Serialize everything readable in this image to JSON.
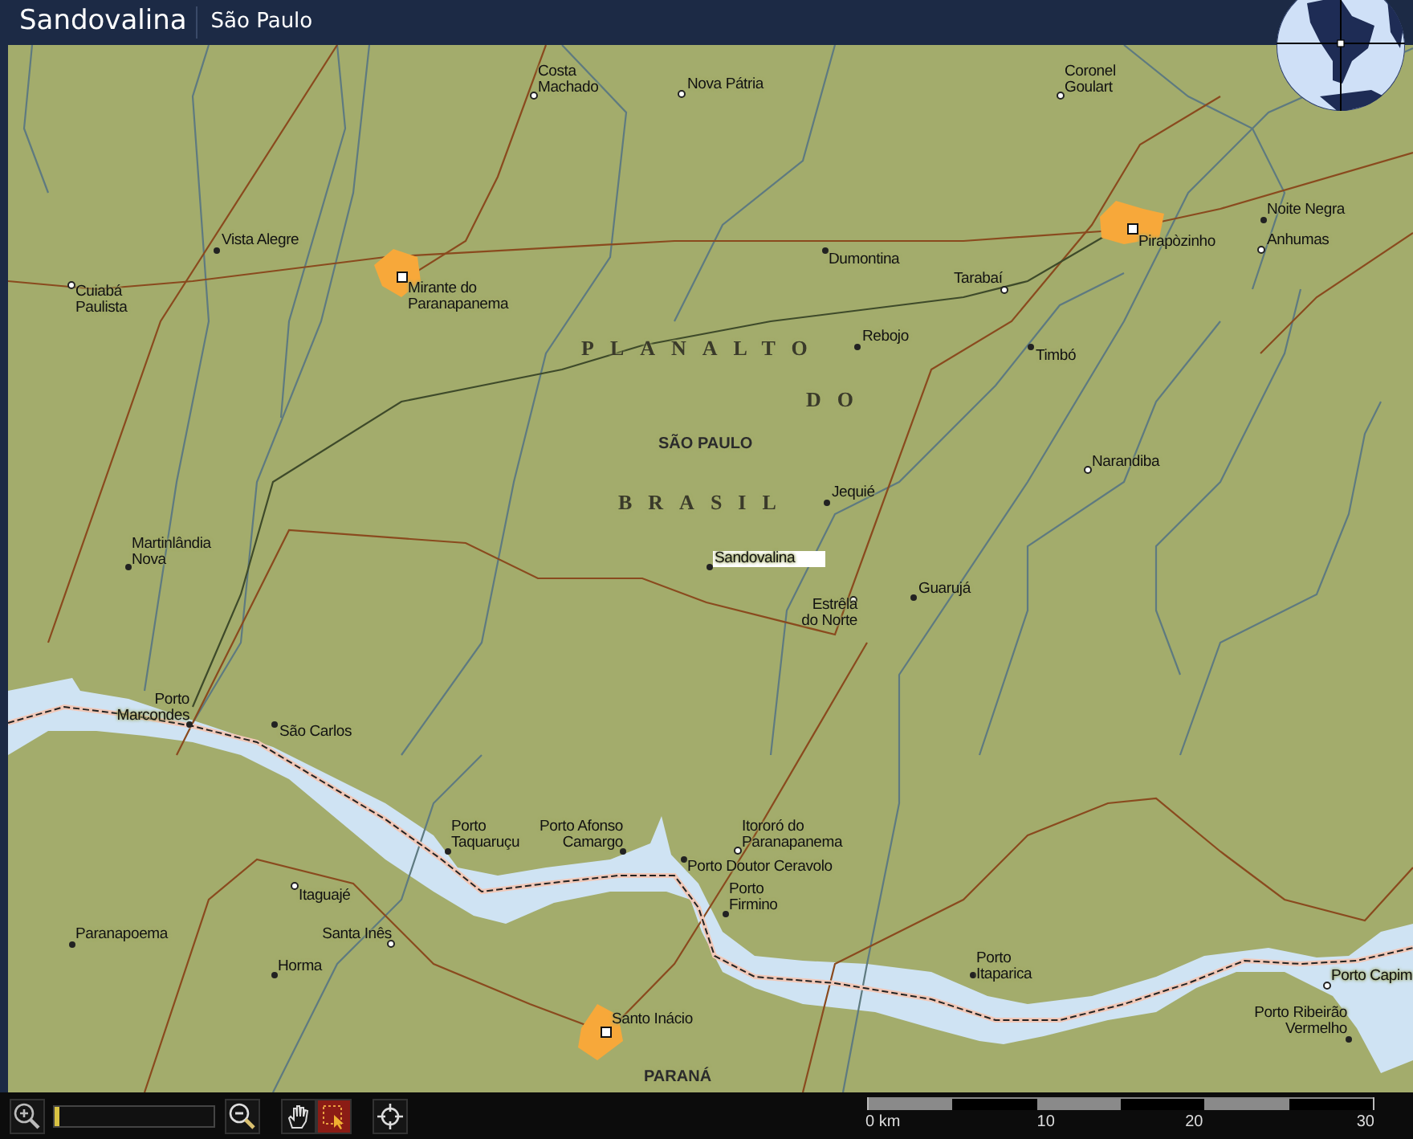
{
  "header": {
    "title": "Sandovalina",
    "subtitle": "São Paulo"
  },
  "map": {
    "places": [
      {
        "name": "Costa Machado",
        "kind": "locality",
        "selected": false
      },
      {
        "name": "Nova Pátria",
        "kind": "locality",
        "selected": false
      },
      {
        "name": "Coronel Goulart",
        "kind": "locality",
        "selected": false
      },
      {
        "name": "Vista Alegre",
        "kind": "village",
        "selected": false
      },
      {
        "name": "Cuiabá Paulista",
        "kind": "locality",
        "selected": false
      },
      {
        "name": "Mirante do Paranapanema",
        "kind": "city",
        "selected": false
      },
      {
        "name": "Dumontina",
        "kind": "village",
        "selected": false
      },
      {
        "name": "Pirapòzinho",
        "kind": "city",
        "selected": false
      },
      {
        "name": "Noite Negra",
        "kind": "village",
        "selected": false
      },
      {
        "name": "Anhumas",
        "kind": "locality",
        "selected": false
      },
      {
        "name": "Tarabaí",
        "kind": "locality",
        "selected": false
      },
      {
        "name": "Rebojo",
        "kind": "village",
        "selected": false
      },
      {
        "name": "Timbó",
        "kind": "village",
        "selected": false
      },
      {
        "name": "Narandiba",
        "kind": "locality",
        "selected": false
      },
      {
        "name": "Jequié",
        "kind": "village",
        "selected": false
      },
      {
        "name": "Sandovalina",
        "kind": "village",
        "selected": true
      },
      {
        "name": "Estrêla do Norte",
        "kind": "locality",
        "selected": false
      },
      {
        "name": "Guarujá",
        "kind": "village",
        "selected": false
      },
      {
        "name": "Martinlândia Nova",
        "kind": "village",
        "selected": false
      },
      {
        "name": "Porto Marcondes",
        "kind": "village",
        "selected": false
      },
      {
        "name": "São Carlos",
        "kind": "village",
        "selected": false
      },
      {
        "name": "Porto Taquaruçu",
        "kind": "village",
        "selected": false
      },
      {
        "name": "Porto Afonso Camargo",
        "kind": "village",
        "selected": false
      },
      {
        "name": "Itororó do Paranapanema",
        "kind": "locality",
        "selected": false
      },
      {
        "name": "Porto Doutor Ceravolo",
        "kind": "village",
        "selected": false
      },
      {
        "name": "Porto Firmino",
        "kind": "village",
        "selected": false
      },
      {
        "name": "Itaguajé",
        "kind": "locality",
        "selected": false
      },
      {
        "name": "Paranapoema",
        "kind": "village",
        "selected": false
      },
      {
        "name": "Santa Inês",
        "kind": "locality",
        "selected": false
      },
      {
        "name": "Horma",
        "kind": "village",
        "selected": false
      },
      {
        "name": "Santo Inácio",
        "kind": "city",
        "selected": false
      },
      {
        "name": "Porto Itaparica",
        "kind": "village",
        "selected": false
      },
      {
        "name": "Porto Capim",
        "kind": "locality",
        "selected": false
      },
      {
        "name": "Porto Ribeirão Vermelho",
        "kind": "village",
        "selected": false
      }
    ],
    "regions": [
      {
        "text": "PLANALTO",
        "kind": "spaced"
      },
      {
        "text": "DO",
        "kind": "spaced"
      },
      {
        "text": "SÃO PAULO",
        "kind": "state"
      },
      {
        "text": "BRASIL",
        "kind": "spaced"
      },
      {
        "text": "PARANÁ",
        "kind": "state"
      }
    ]
  },
  "toolbar": {
    "tools": [
      {
        "kind": "zoom_in"
      },
      {
        "kind": "zoom_slider",
        "level": 0.03
      },
      {
        "kind": "zoom_out"
      },
      {
        "kind": "pan",
        "selected": false
      },
      {
        "kind": "select",
        "selected": true
      },
      {
        "kind": "locate"
      }
    ],
    "scale_bar": {
      "labels": [
        "0 km",
        "10",
        "20",
        "30"
      ]
    }
  }
}
